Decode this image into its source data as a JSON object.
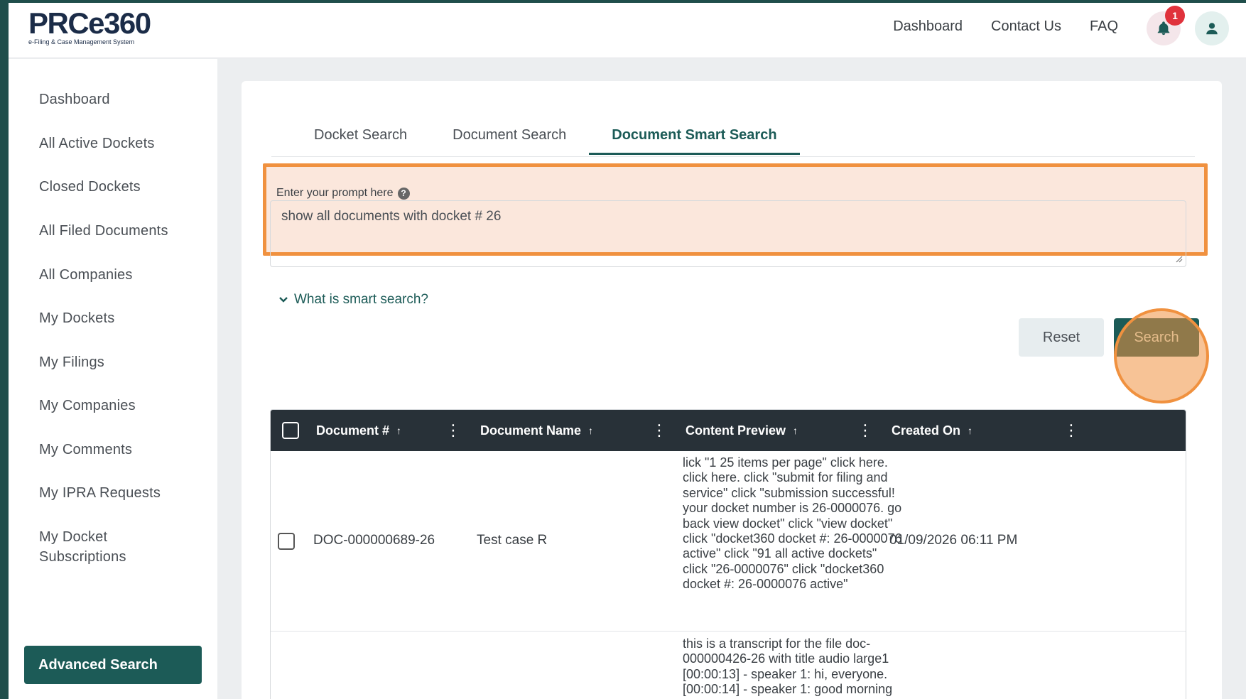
{
  "logo": {
    "main": "PRCe360",
    "subtitle": "e-Filing & Case Management System"
  },
  "top_nav": {
    "dashboard": "Dashboard",
    "contact": "Contact Us",
    "faq": "FAQ",
    "notification_count": "1"
  },
  "sidebar": {
    "items": [
      "Dashboard",
      "All Active Dockets",
      "Closed Dockets",
      "All Filed Documents",
      "All Companies",
      "My Dockets",
      "My Filings",
      "My Companies",
      "My Comments",
      "My IPRA Requests",
      "My Docket Subscriptions"
    ],
    "active": "Advanced Search"
  },
  "tabs": [
    "Docket Search",
    "Document Search",
    "Document Smart Search"
  ],
  "prompt": {
    "label": "Enter your prompt here",
    "value": "show all documents with docket # 26"
  },
  "smart_link": "What is smart search?",
  "buttons": {
    "reset": "Reset",
    "search": "Search"
  },
  "table": {
    "columns": [
      "Document #",
      "Document Name",
      "Content Preview",
      "Created On"
    ],
    "rows": [
      {
        "doc_no": "DOC-000000689-26",
        "name": "Test case R",
        "preview": "lick \"1 25 items per page\" click here. click here. click \"submit for filing and service\" click \"submission successful! your docket number is 26-0000076. go back view docket\" click \"view docket\" click \"docket360 docket #: 26-0000076 active\" click \"91 all active dockets\" click \"26-0000076\" click \"docket360 docket #: 26-0000076 active\"",
        "created": "01/09/2026 06:11 PM"
      },
      {
        "doc_no": "",
        "name": "",
        "preview": "this is a transcript for the file doc-000000426-26 with title audio large1 [00:00:13] - speaker 1: hi, everyone. [00:00:14] - speaker 1: good morning",
        "created": ""
      }
    ]
  },
  "colors": {
    "brand": "#1c5b57",
    "highlight": "#f0913f",
    "header_dark": "#283138"
  }
}
